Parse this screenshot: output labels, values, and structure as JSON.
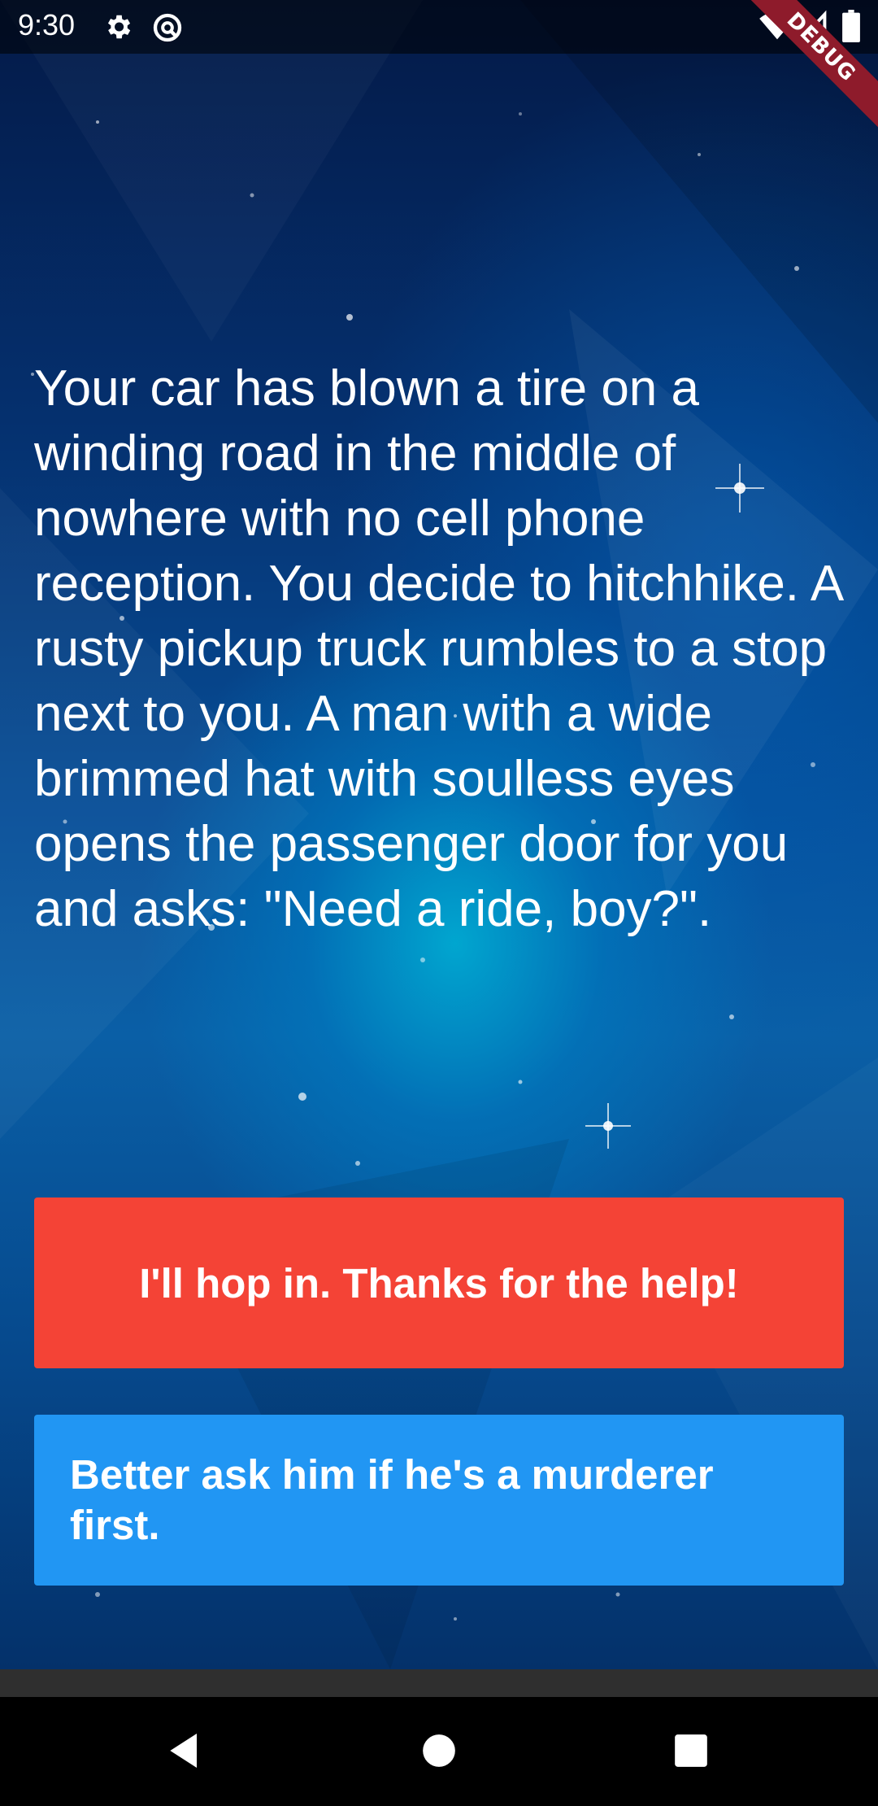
{
  "status_bar": {
    "time": "9:30",
    "icons": [
      "gear-icon",
      "sync-icon",
      "wifi-icon",
      "signal-icon",
      "battery-icon"
    ]
  },
  "debug_banner": {
    "label": "DEBUG"
  },
  "story": {
    "text": "Your car has blown a tire on a winding road in the middle of nowhere with no cell phone reception. You decide to hitchhike. A rusty pickup truck rumbles to a stop next to you. A man with a wide brimmed hat with soulless eyes opens the passenger door for you and asks: \"Need a ride, boy?\"."
  },
  "choices": [
    {
      "label": "I'll hop in. Thanks for the help!",
      "color": "#f44336"
    },
    {
      "label": "Better ask him if he's a murderer first.",
      "color": "#2196f3"
    }
  ],
  "nav_bar": {
    "icons": [
      "back-icon",
      "home-icon",
      "recents-icon"
    ]
  }
}
